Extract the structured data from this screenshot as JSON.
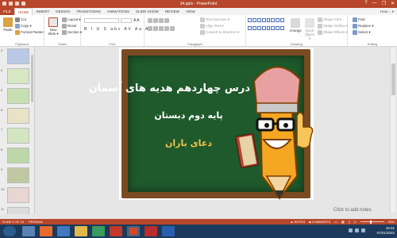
{
  "window": {
    "title": "34.pptx - PowerPoint",
    "controls": [
      "?",
      "—",
      "❐",
      "✕"
    ]
  },
  "ribbon_tabs": [
    "FILE",
    "HOME",
    "INSERT",
    "DESIGN",
    "TRANSITIONS",
    "ANIMATIONS",
    "SLIDE SHOW",
    "REVIEW",
    "VIEW"
  ],
  "user": "Hour... ▾",
  "clipboard": {
    "paste": "Paste",
    "cut": "Cut",
    "copy": "Copy ▾",
    "format_painter": "Format Painter",
    "label": "Clipboard"
  },
  "slides_group": {
    "new_slide": "New Slide ▾",
    "layout": "Layout ▾",
    "reset": "Reset",
    "section": "Section ▾",
    "label": "Slides"
  },
  "font_group": {
    "format_row": "B I U S abc AV Aa A",
    "label": "Font"
  },
  "paragraph_group": {
    "text_direction": "Text Direction ▾",
    "align_text": "Align Text ▾",
    "convert": "Convert to SmartArt ▾",
    "label": "Paragraph"
  },
  "drawing_group": {
    "arrange": "Arrange",
    "quick_styles": "Quick Styles ▾",
    "shape_fill": "Shape Fill ▾",
    "shape_outline": "Shape Outline ▾",
    "shape_effects": "Shape Effects ▾",
    "label": "Drawing"
  },
  "editing_group": {
    "find": "Find",
    "replace": "Replace ▾",
    "select": "Select ▾",
    "label": "Editing"
  },
  "thumbnails": [
    {
      "num": "3",
      "color": "#b9c9e6"
    },
    {
      "num": "4",
      "color": "#d8e8c2"
    },
    {
      "num": "5",
      "color": "#c7dfb2"
    },
    {
      "num": "6",
      "color": "#e9e3c5"
    },
    {
      "num": "7",
      "color": "#d4e6c1"
    },
    {
      "num": "8",
      "color": "#bdd7a8"
    },
    {
      "num": "9",
      "color": "#c0c8a2"
    },
    {
      "num": "10",
      "color": "#e8d6d2"
    },
    {
      "num": "11",
      "color": "#dcdcdc"
    }
  ],
  "slide": {
    "line1": "درس چهاردهم هدیه های آسمان",
    "line2": "پایه دوم دبستان",
    "line3": "دعای باران",
    "text_color_highlight": "#f6c34a",
    "board_color": "#1f5a2c",
    "frame_color": "#7a4a23"
  },
  "notes_hint": "Click to add notes",
  "status": {
    "slide_of": "SLIDE 2 OF 14",
    "language": "PERSIAN",
    "notes": "▲ NOTES",
    "comments": "■ COMMENTS",
    "zoom": "53%"
  },
  "taskbar": {
    "apps": [
      "start",
      "explorer",
      "firefox",
      "media-player",
      "file-manager",
      "chrome",
      "maps",
      "powerpoint",
      "pdf",
      "word"
    ],
    "time": "16:01",
    "date": "07/01/2022"
  },
  "accent": "#b7472a"
}
